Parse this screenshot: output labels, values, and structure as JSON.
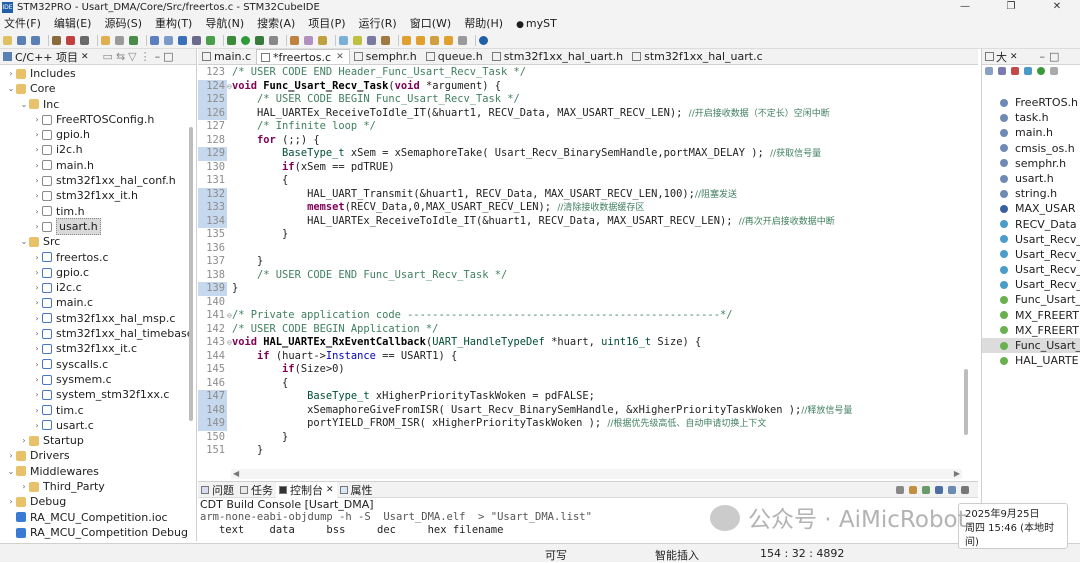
{
  "window": {
    "app_label": "IDE",
    "title": "STM32PRO - Usart_DMA/Core/Src/freertos.c - STM32CubeIDE",
    "minimize": "—",
    "maximize": "❐",
    "close": "✕"
  },
  "menu": [
    "文件(F)",
    "编辑(E)",
    "源码(S)",
    "重构(T)",
    "导航(N)",
    "搜索(A)",
    "项目(P)",
    "运行(R)",
    "窗口(W)",
    "帮助(H)",
    "myST"
  ],
  "left_panel": {
    "title": "C/C++ 项目",
    "tree": [
      {
        "depth": 1,
        "tw": "›",
        "icon": "fold",
        "label": "Includes"
      },
      {
        "depth": 1,
        "tw": "⌄",
        "icon": "fold",
        "label": "Core"
      },
      {
        "depth": 2,
        "tw": "⌄",
        "icon": "fold",
        "label": "Inc"
      },
      {
        "depth": 3,
        "tw": "›",
        "icon": "fh",
        "label": "FreeRTOSConfig.h"
      },
      {
        "depth": 3,
        "tw": "›",
        "icon": "fh",
        "label": "gpio.h"
      },
      {
        "depth": 3,
        "tw": "›",
        "icon": "fh",
        "label": "i2c.h"
      },
      {
        "depth": 3,
        "tw": "›",
        "icon": "fh",
        "label": "main.h"
      },
      {
        "depth": 3,
        "tw": "›",
        "icon": "fh",
        "label": "stm32f1xx_hal_conf.h"
      },
      {
        "depth": 3,
        "tw": "›",
        "icon": "fh",
        "label": "stm32f1xx_it.h"
      },
      {
        "depth": 3,
        "tw": "›",
        "icon": "fh",
        "label": "tim.h"
      },
      {
        "depth": 3,
        "tw": "›",
        "icon": "fh",
        "label": "usart.h",
        "selected": true
      },
      {
        "depth": 2,
        "tw": "⌄",
        "icon": "fold",
        "label": "Src"
      },
      {
        "depth": 3,
        "tw": "›",
        "icon": "fc",
        "label": "freertos.c"
      },
      {
        "depth": 3,
        "tw": "›",
        "icon": "fc",
        "label": "gpio.c"
      },
      {
        "depth": 3,
        "tw": "›",
        "icon": "fc",
        "label": "i2c.c"
      },
      {
        "depth": 3,
        "tw": "›",
        "icon": "fc",
        "label": "main.c"
      },
      {
        "depth": 3,
        "tw": "›",
        "icon": "fc",
        "label": "stm32f1xx_hal_msp.c"
      },
      {
        "depth": 3,
        "tw": "›",
        "icon": "fc",
        "label": "stm32f1xx_hal_timebase"
      },
      {
        "depth": 3,
        "tw": "›",
        "icon": "fc",
        "label": "stm32f1xx_it.c"
      },
      {
        "depth": 3,
        "tw": "›",
        "icon": "fc",
        "label": "syscalls.c"
      },
      {
        "depth": 3,
        "tw": "›",
        "icon": "fc",
        "label": "sysmem.c"
      },
      {
        "depth": 3,
        "tw": "›",
        "icon": "fc",
        "label": "system_stm32f1xx.c"
      },
      {
        "depth": 3,
        "tw": "›",
        "icon": "fc",
        "label": "tim.c"
      },
      {
        "depth": 3,
        "tw": "›",
        "icon": "fc",
        "label": "usart.c"
      },
      {
        "depth": 2,
        "tw": "›",
        "icon": "fold",
        "label": "Startup"
      },
      {
        "depth": 1,
        "tw": "›",
        "icon": "fold",
        "label": "Drivers"
      },
      {
        "depth": 1,
        "tw": "⌄",
        "icon": "fold",
        "label": "Middlewares"
      },
      {
        "depth": 2,
        "tw": "›",
        "icon": "fold",
        "label": "Third_Party"
      },
      {
        "depth": 1,
        "tw": "›",
        "icon": "fold",
        "label": "Debug"
      },
      {
        "depth": 1,
        "tw": "",
        "icon": "fx",
        "label": "RA_MCU_Competition.ioc"
      },
      {
        "depth": 1,
        "tw": "",
        "icon": "fx",
        "label": "RA_MCU_Competition Debug"
      }
    ]
  },
  "editor": {
    "tabs": [
      {
        "label": "main.c"
      },
      {
        "label": "*freertos.c",
        "active": true,
        "close": "✕"
      },
      {
        "label": "semphr.h"
      },
      {
        "label": "queue.h"
      },
      {
        "label": "stm32f1xx_hal_uart.h"
      },
      {
        "label": "stm32f1xx_hal_uart.c"
      }
    ],
    "lines": [
      {
        "n": "123",
        "t": [
          [
            "cm",
            "/* USER CODE END Header_Func_Usart_Recv_Task */"
          ]
        ]
      },
      {
        "n": "124",
        "hl": true,
        "fold": "⊖",
        "t": [
          [
            "kw",
            "void "
          ],
          [
            "fn",
            "Func_Usart_Recv_Task"
          ],
          [
            "",
            "("
          ],
          [
            "kw",
            "void "
          ],
          [
            "",
            "*argument) {"
          ]
        ]
      },
      {
        "n": "125",
        "hl": true,
        "t": [
          [
            "",
            "    "
          ],
          [
            "cm",
            "/* USER CODE BEGIN Func_Usart_Recv_Task */"
          ]
        ]
      },
      {
        "n": "126",
        "hl": true,
        "t": [
          [
            "",
            "    HAL_UARTEx_ReceiveToIdle_IT(&huart1, RECV_Data, MAX_USART_RECV_LEN); "
          ],
          [
            "cm2",
            "//开启接收数据（不定长）空闲中断"
          ]
        ]
      },
      {
        "n": "127",
        "t": [
          [
            "",
            "    "
          ],
          [
            "cm",
            "/* Infinite loop */"
          ]
        ]
      },
      {
        "n": "128",
        "t": [
          [
            "",
            "    "
          ],
          [
            "kw",
            "for "
          ],
          [
            "",
            "(;;) {"
          ]
        ]
      },
      {
        "n": "129",
        "hl": true,
        "t": [
          [
            "",
            "        "
          ],
          [
            "ty",
            "BaseType_t"
          ],
          [
            "",
            " xSem = xSemaphoreTake( Usart_Recv_BinarySemHandle,portMAX_DELAY ); "
          ],
          [
            "cm2",
            "//获取信号量"
          ]
        ]
      },
      {
        "n": "130",
        "t": [
          [
            "",
            "        "
          ],
          [
            "kw",
            "if"
          ],
          [
            "",
            "(xSem == pdTRUE)"
          ]
        ]
      },
      {
        "n": "131",
        "t": [
          [
            "",
            "        {"
          ]
        ]
      },
      {
        "n": "132",
        "hl": true,
        "t": [
          [
            "",
            "            HAL_UART_Transmit(&huart1, RECV_Data, MAX_USART_RECV_LEN,100);"
          ],
          [
            "cm2",
            "//阻塞发送"
          ]
        ]
      },
      {
        "n": "133",
        "hl": true,
        "t": [
          [
            "",
            "            "
          ],
          [
            "kw",
            "memset"
          ],
          [
            "",
            "(RECV_Data,0,MAX_USART_RECV_LEN); "
          ],
          [
            "cm2",
            "//清除接收数据缓存区"
          ]
        ]
      },
      {
        "n": "134",
        "hl": true,
        "t": [
          [
            "",
            "            HAL_UARTEx_ReceiveToIdle_IT(&huart1, RECV_Data, MAX_USART_RECV_LEN); "
          ],
          [
            "cm2",
            "//再次开启接收数据中断"
          ]
        ]
      },
      {
        "n": "135",
        "t": [
          [
            "",
            "        }"
          ]
        ]
      },
      {
        "n": "136",
        "t": [
          [
            "",
            ""
          ]
        ]
      },
      {
        "n": "137",
        "t": [
          [
            "",
            "    }"
          ]
        ]
      },
      {
        "n": "138",
        "t": [
          [
            "",
            "    "
          ],
          [
            "cm",
            "/* USER CODE END Func_Usart_Recv_Task */"
          ]
        ]
      },
      {
        "n": "139",
        "hl": true,
        "t": [
          [
            "",
            "}"
          ]
        ]
      },
      {
        "n": "140",
        "t": [
          [
            "",
            ""
          ]
        ]
      },
      {
        "n": "141",
        "fold": "⊖",
        "t": [
          [
            "cm",
            "/* Private application code --------------------------------------------------*/"
          ]
        ]
      },
      {
        "n": "142",
        "t": [
          [
            "cm",
            "/* USER CODE BEGIN Application */"
          ]
        ]
      },
      {
        "n": "143",
        "fold": "⊖",
        "t": [
          [
            "kw",
            "void "
          ],
          [
            "fn",
            "HAL_UARTEx_RxEventCallback"
          ],
          [
            "",
            "("
          ],
          [
            "ty",
            "UART_HandleTypeDef"
          ],
          [
            "",
            " *huart, "
          ],
          [
            "ty",
            "uint16_t"
          ],
          [
            "",
            " Size) {"
          ]
        ]
      },
      {
        "n": "144",
        "t": [
          [
            "",
            "    "
          ],
          [
            "kw",
            "if "
          ],
          [
            "",
            "(huart->"
          ],
          [
            "inst",
            "Instance"
          ],
          [
            "",
            " == USART1) {"
          ]
        ]
      },
      {
        "n": "145",
        "t": [
          [
            "",
            "        "
          ],
          [
            "kw",
            "if"
          ],
          [
            "",
            "(Size>0)"
          ]
        ]
      },
      {
        "n": "146",
        "t": [
          [
            "",
            "        {"
          ]
        ]
      },
      {
        "n": "147",
        "hl": true,
        "t": [
          [
            "",
            "            "
          ],
          [
            "ty",
            "BaseType_t"
          ],
          [
            "",
            " xHigherPriorityTaskWoken = pdFALSE;"
          ]
        ]
      },
      {
        "n": "148",
        "hl": true,
        "t": [
          [
            "",
            "            xSemaphoreGiveFromISR( Usart_Recv_BinarySemHandle, &xHigherPriorityTaskWoken );"
          ],
          [
            "cm2",
            "//释放信号量"
          ]
        ]
      },
      {
        "n": "149",
        "hl": true,
        "t": [
          [
            "",
            "            portYIELD_FROM_ISR( xHigherPriorityTaskWoken ); "
          ],
          [
            "cm2",
            "//根据优先级高低、自动申请切换上下文"
          ]
        ]
      },
      {
        "n": "150",
        "t": [
          [
            "",
            "        }"
          ]
        ]
      },
      {
        "n": "151",
        "t": [
          [
            "",
            "    }"
          ]
        ]
      }
    ]
  },
  "outline": {
    "title": "大",
    "items": [
      {
        "icon": "#6d8ab5",
        "label": "FreeRTOS.h"
      },
      {
        "icon": "#6d8ab5",
        "label": "task.h"
      },
      {
        "icon": "#6d8ab5",
        "label": "main.h"
      },
      {
        "icon": "#6d8ab5",
        "label": "cmsis_os.h"
      },
      {
        "icon": "#6d8ab5",
        "label": "semphr.h"
      },
      {
        "icon": "#6d8ab5",
        "label": "usart.h"
      },
      {
        "icon": "#6d8ab5",
        "label": "string.h"
      },
      {
        "icon": "#3a5fa0",
        "label": "MAX_USAR"
      },
      {
        "icon": "#4a9cc9",
        "label": "RECV_Data"
      },
      {
        "icon": "#4a9cc9",
        "label": "Usart_Recv_"
      },
      {
        "icon": "#4a9cc9",
        "label": "Usart_Recv_"
      },
      {
        "icon": "#4a9cc9",
        "label": "Usart_Recv_"
      },
      {
        "icon": "#4a9cc9",
        "label": "Usart_Recv_"
      },
      {
        "icon": "#6aaf50",
        "label": "Func_Usart_"
      },
      {
        "icon": "#6aaf50",
        "label": "MX_FREERT"
      },
      {
        "icon": "#6aaf50",
        "label": "MX_FREERT"
      },
      {
        "icon": "#6aaf50",
        "label": "Func_Usart_",
        "selected": true
      },
      {
        "icon": "#6aaf50",
        "label": "HAL_UARTE"
      }
    ]
  },
  "console": {
    "tabs": [
      "问题",
      "任务",
      "控制台",
      "属性"
    ],
    "active_tab": "控制台",
    "header": "CDT Build Console [Usart_DMA]",
    "lines": [
      "arm-none-eabi-objdump -h -S  Usart_DMA.elf  > \"Usart_DMA.list\"",
      "   text    data     bss     dec     hex filename"
    ]
  },
  "status": {
    "writable": "可写",
    "insert_mode": "智能插入",
    "position": "154 : 32 : 4892"
  },
  "clock": {
    "date": "2025年9月25日",
    "time": "周四 15:46 (本地时间)"
  },
  "watermark": {
    "text": "公众号 · AiMicRobot"
  }
}
